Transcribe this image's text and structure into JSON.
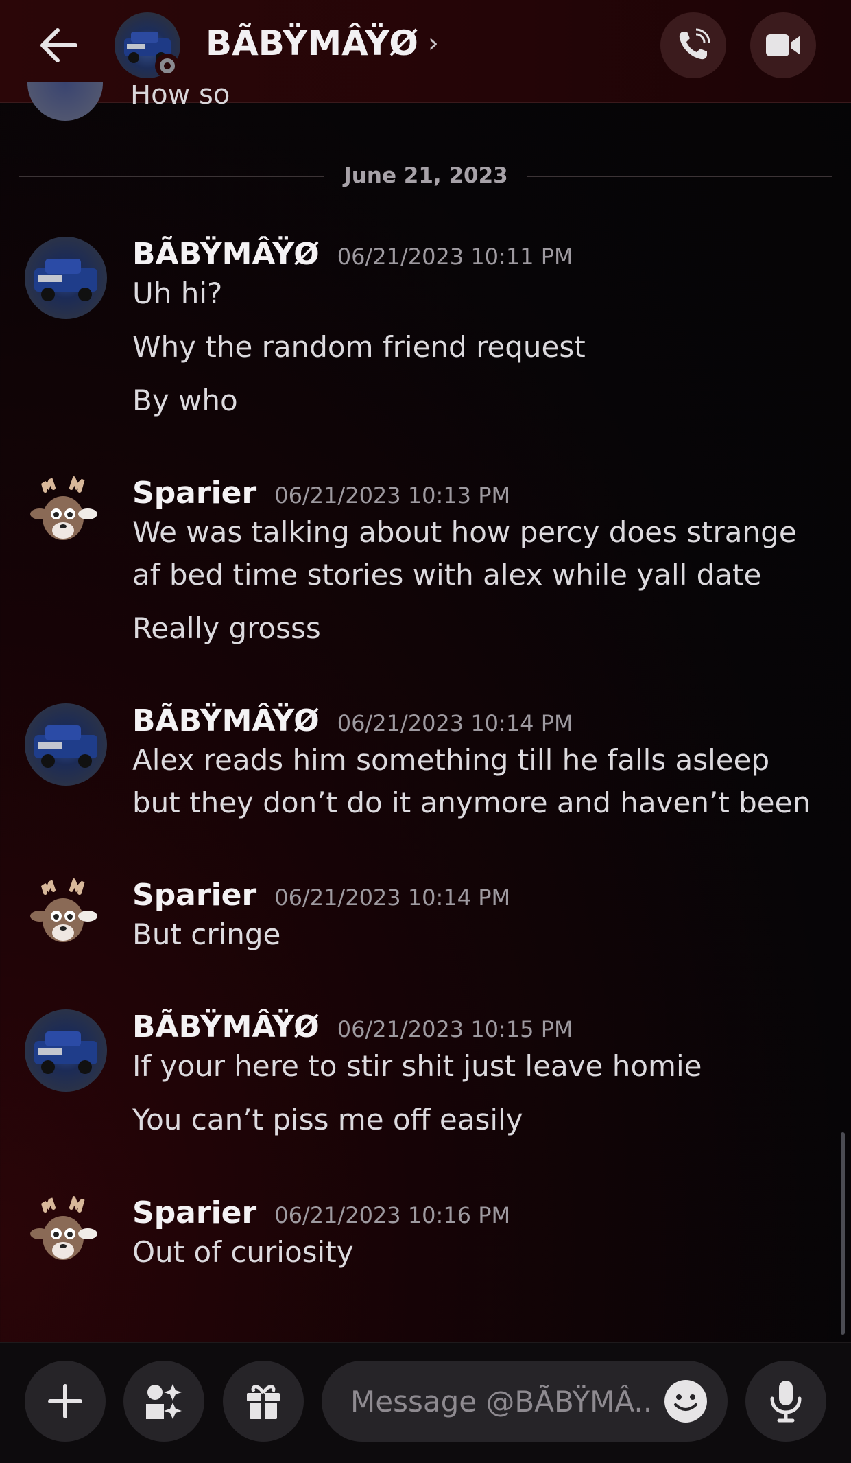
{
  "header": {
    "title": "BÃBŸMÂŸØ",
    "chevron": "›",
    "icons": {
      "back": "arrow-left-icon",
      "call": "phone-icon",
      "video": "video-camera-icon"
    }
  },
  "cut_off_message": "How so",
  "date_divider": "June 21, 2023",
  "messages": [
    {
      "author": "BÃBŸMÂŸØ",
      "time": "06/21/2023 10:11 PM",
      "lines": [
        "Uh hi?",
        "Why the random friend request",
        "By who"
      ]
    },
    {
      "author": "Sparier",
      "time": "06/21/2023 10:13 PM",
      "lines": [
        "We was talking about how percy does strange af bed time stories with alex while yall date",
        "Really grosss"
      ]
    },
    {
      "author": "BÃBŸMÂŸØ",
      "time": "06/21/2023 10:14 PM",
      "lines": [
        "Alex reads him something till he falls asleep but they don’t do it anymore and haven’t been"
      ]
    },
    {
      "author": "Sparier",
      "time": "06/21/2023 10:14 PM",
      "lines": [
        "But cringe"
      ]
    },
    {
      "author": "BÃBŸMÂŸØ",
      "time": "06/21/2023 10:15 PM",
      "lines": [
        "If your here to stir shit just leave homie",
        "You can’t piss me off easily"
      ]
    },
    {
      "author": "Sparier",
      "time": "06/21/2023 10:16 PM",
      "lines": [
        "Out of curiosity"
      ]
    }
  ],
  "composer": {
    "placeholder": "Message @BÃBŸMÂ..",
    "icons": {
      "add": "plus-icon",
      "apps": "apps-icon",
      "gift": "gift-icon",
      "emoji": "emoji-icon",
      "voice": "microphone-icon"
    }
  },
  "colors": {
    "header_bg": "#240507",
    "button_bg": "#3b1b1d",
    "composer_bg": "#0d0b0d",
    "text": "#dcdade",
    "timestamp": "#9e9aa0"
  }
}
